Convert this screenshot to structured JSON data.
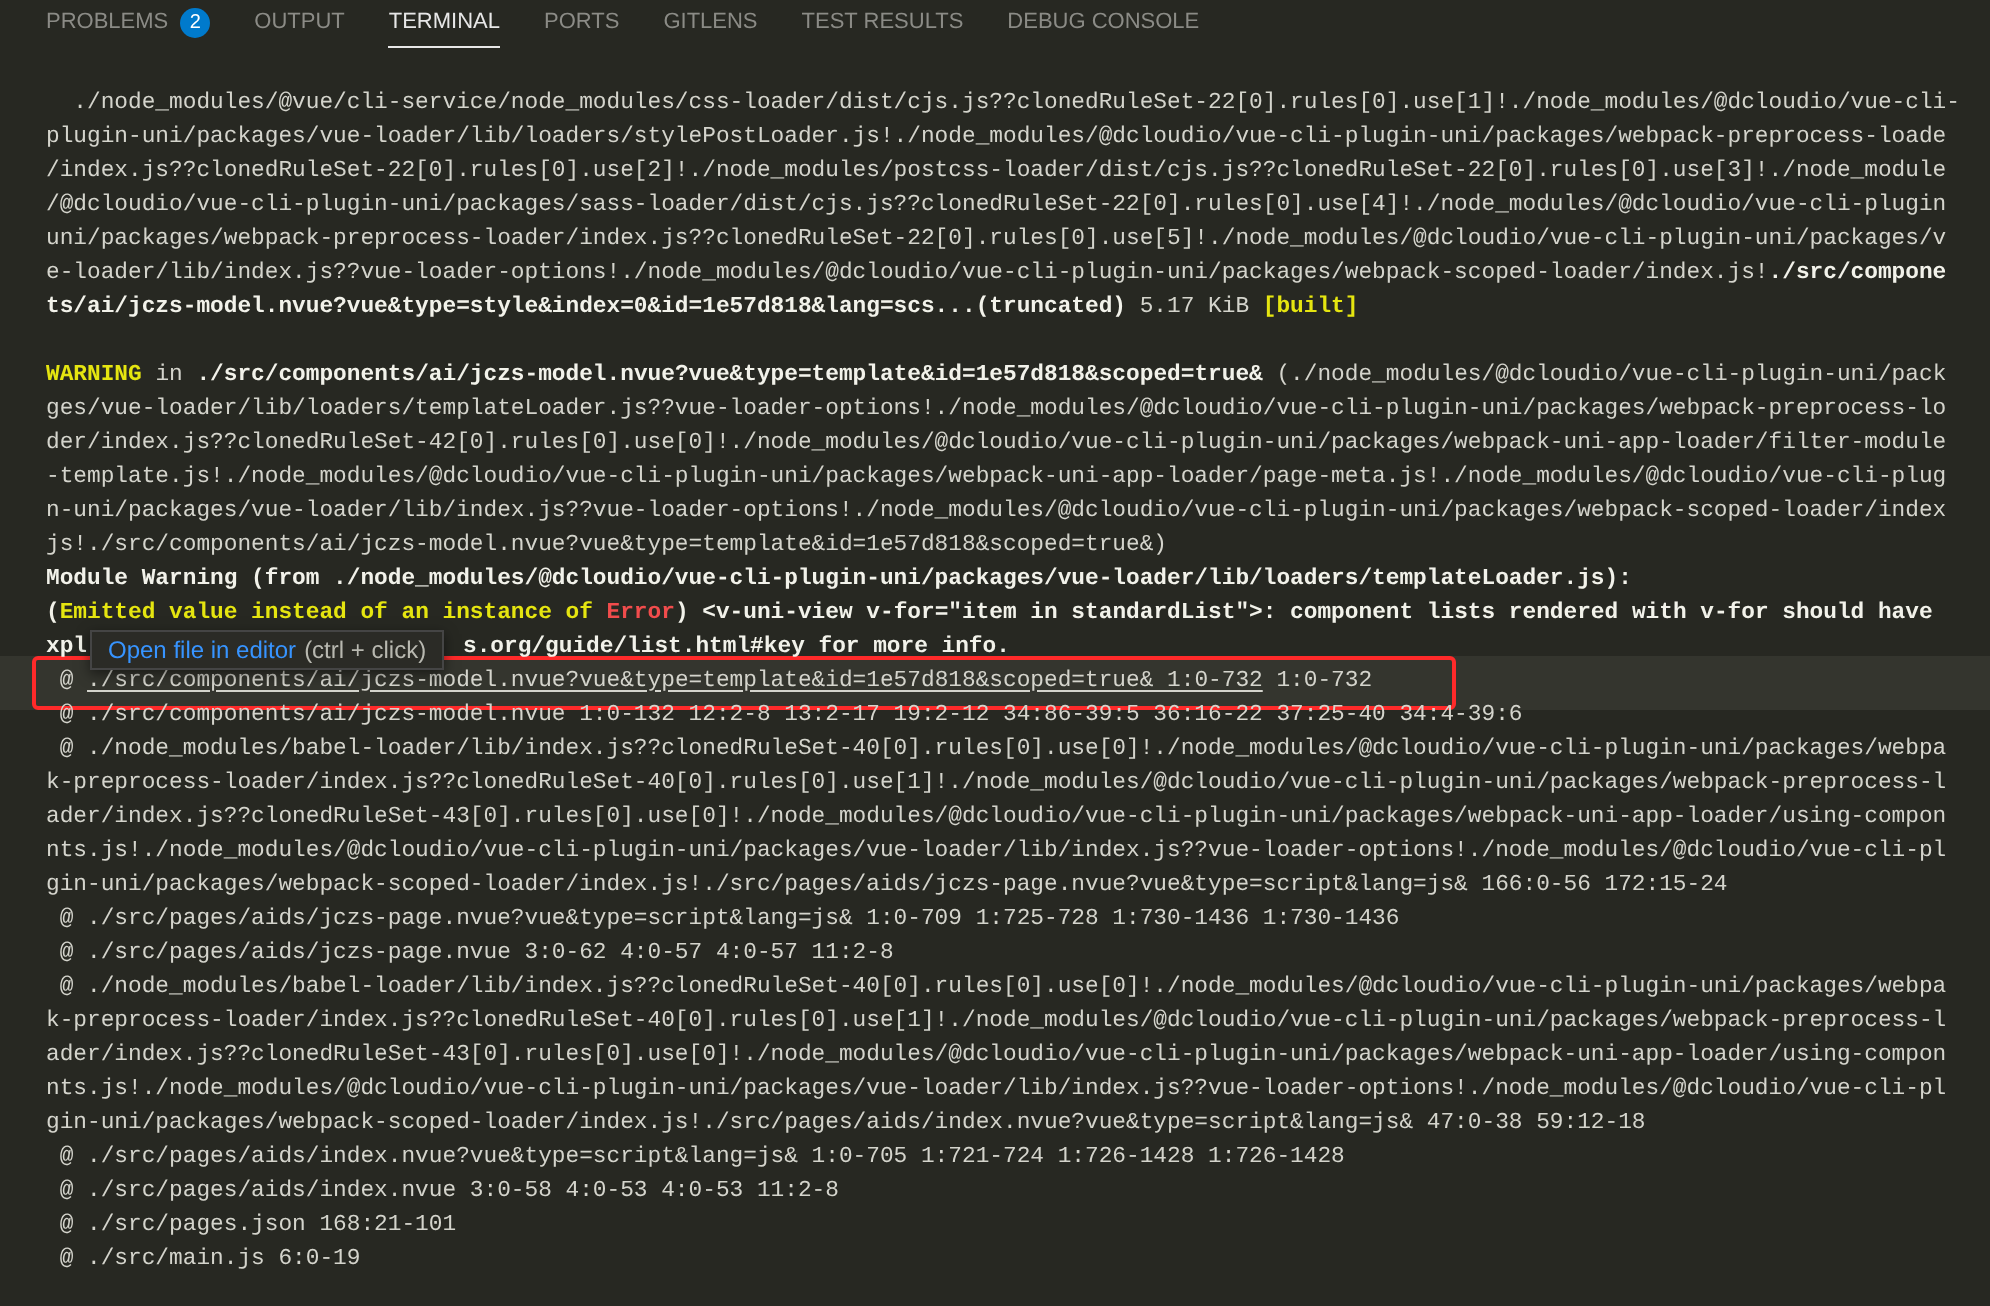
{
  "tabs": [
    {
      "label": "PROBLEMS",
      "selected": false,
      "badge": "2"
    },
    {
      "label": "OUTPUT",
      "selected": false
    },
    {
      "label": "TERMINAL",
      "selected": true
    },
    {
      "label": "PORTS",
      "selected": false
    },
    {
      "label": "GITLENS",
      "selected": false
    },
    {
      "label": "TEST RESULTS",
      "selected": false
    },
    {
      "label": "DEBUG CONSOLE",
      "selected": false
    }
  ],
  "terminal": {
    "lines": [
      {
        "kind": "text",
        "segments": [
          {
            "kind": "plain",
            "text": "  ./node_modules/@vue/cli-service/node_modules/css-loader/dist/cjs.js??clonedRuleSet-22[0].rules[0].use[1]!./node_modules/@dcloudio/vue-cli-"
          }
        ]
      },
      {
        "kind": "text",
        "segments": [
          {
            "kind": "plain",
            "text": "plugin-uni/packages/vue-loader/lib/loaders/stylePostLoader.js!./node_modules/@dcloudio/vue-cli-plugin-uni/packages/webpack-preprocess-loade"
          }
        ]
      },
      {
        "kind": "text",
        "segments": [
          {
            "kind": "plain",
            "text": "/index.js??clonedRuleSet-22[0].rules[0].use[2]!./node_modules/postcss-loader/dist/cjs.js??clonedRuleSet-22[0].rules[0].use[3]!./node_module"
          }
        ]
      },
      {
        "kind": "text",
        "segments": [
          {
            "kind": "plain",
            "text": "/@dcloudio/vue-cli-plugin-uni/packages/sass-loader/dist/cjs.js??clonedRuleSet-22[0].rules[0].use[4]!./node_modules/@dcloudio/vue-cli-plugin"
          }
        ]
      },
      {
        "kind": "text",
        "segments": [
          {
            "kind": "plain",
            "text": "uni/packages/webpack-preprocess-loader/index.js??clonedRuleSet-22[0].rules[0].use[5]!./node_modules/@dcloudio/vue-cli-plugin-uni/packages/v"
          }
        ]
      },
      {
        "kind": "text",
        "segments": [
          {
            "kind": "plain",
            "text": "e-loader/lib/index.js??vue-loader-options!./node_modules/@dcloudio/vue-cli-plugin-uni/packages/webpack-scoped-loader/index.js!"
          },
          {
            "kind": "bold",
            "text": "./src/compone"
          }
        ]
      },
      {
        "kind": "text",
        "segments": [
          {
            "kind": "bold",
            "text": "ts/ai/jczs-model.nvue?vue&type=style&index=0&id=1e57d818&lang=scs...(truncated)"
          },
          {
            "kind": "plain",
            "text": " 5.17 KiB "
          },
          {
            "kind": "yellow",
            "text": "[built]"
          }
        ]
      },
      {
        "kind": "blank"
      },
      {
        "kind": "text",
        "segments": [
          {
            "kind": "warn",
            "text": "WARNING"
          },
          {
            "kind": "plain",
            "text": " in "
          },
          {
            "kind": "bold",
            "text": "./src/components/ai/jczs-model.nvue?vue&type=template&id=1e57d818&scoped=true&"
          },
          {
            "kind": "plain",
            "text": " (./node_modules/@dcloudio/vue-cli-plugin-uni/pack"
          }
        ]
      },
      {
        "kind": "text",
        "segments": [
          {
            "kind": "plain",
            "text": "ges/vue-loader/lib/loaders/templateLoader.js??vue-loader-options!./node_modules/@dcloudio/vue-cli-plugin-uni/packages/webpack-preprocess-lo"
          }
        ]
      },
      {
        "kind": "text",
        "segments": [
          {
            "kind": "plain",
            "text": "der/index.js??clonedRuleSet-42[0].rules[0].use[0]!./node_modules/@dcloudio/vue-cli-plugin-uni/packages/webpack-uni-app-loader/filter-module"
          }
        ]
      },
      {
        "kind": "text",
        "segments": [
          {
            "kind": "plain",
            "text": "-template.js!./node_modules/@dcloudio/vue-cli-plugin-uni/packages/webpack-uni-app-loader/page-meta.js!./node_modules/@dcloudio/vue-cli-plug"
          }
        ]
      },
      {
        "kind": "text",
        "segments": [
          {
            "kind": "plain",
            "text": "n-uni/packages/vue-loader/lib/index.js??vue-loader-options!./node_modules/@dcloudio/vue-cli-plugin-uni/packages/webpack-scoped-loader/index"
          }
        ]
      },
      {
        "kind": "text",
        "segments": [
          {
            "kind": "plain",
            "text": "js!./src/components/ai/jczs-model.nvue?vue&type=template&id=1e57d818&scoped=true&)"
          }
        ]
      },
      {
        "kind": "text",
        "segments": [
          {
            "kind": "bold",
            "text": "Module Warning (from ./node_modules/@dcloudio/vue-cli-plugin-uni/packages/vue-loader/lib/loaders/templateLoader.js):"
          }
        ]
      },
      {
        "kind": "text",
        "segments": [
          {
            "kind": "bold",
            "text": "("
          },
          {
            "kind": "yellow",
            "text": "Emitted value instead of an instance of "
          },
          {
            "kind": "error",
            "text": "Error"
          },
          {
            "kind": "bold",
            "text": ") <v-uni-view v-for=\"item in standardList\">: component lists rendered with v-for should have"
          }
        ]
      },
      {
        "kind": "fragments",
        "segments": [
          {
            "kind": "bold",
            "text": "xpl"
          },
          {
            "kind": "bold",
            "text": "s.org/guide/list.html#key for more info."
          }
        ]
      },
      {
        "kind": "annotated",
        "segments": [
          {
            "kind": "plain",
            "text": " @ "
          },
          {
            "kind": "link",
            "text": "./src/components/ai/jczs-model.nvue?vue&type=template&id=1e57d818&scoped=true& 1:0-732"
          },
          {
            "kind": "plain",
            "text": " 1:0-732"
          }
        ]
      },
      {
        "kind": "text",
        "segments": [
          {
            "kind": "plain",
            "text": " @ ./src/components/ai/jczs-model.nvue 1:0-132 12:2-8 13:2-17 19:2-12 34:86-39:5 36:16-22 37:25-40 34:4-39:6"
          }
        ]
      },
      {
        "kind": "text",
        "segments": [
          {
            "kind": "plain",
            "text": " @ ./node_modules/babel-loader/lib/index.js??clonedRuleSet-40[0].rules[0].use[0]!./node_modules/@dcloudio/vue-cli-plugin-uni/packages/webpa"
          }
        ]
      },
      {
        "kind": "text",
        "segments": [
          {
            "kind": "plain",
            "text": "k-preprocess-loader/index.js??clonedRuleSet-40[0].rules[0].use[1]!./node_modules/@dcloudio/vue-cli-plugin-uni/packages/webpack-preprocess-l"
          }
        ]
      },
      {
        "kind": "text",
        "segments": [
          {
            "kind": "plain",
            "text": "ader/index.js??clonedRuleSet-43[0].rules[0].use[0]!./node_modules/@dcloudio/vue-cli-plugin-uni/packages/webpack-uni-app-loader/using-compon"
          }
        ]
      },
      {
        "kind": "text",
        "segments": [
          {
            "kind": "plain",
            "text": "nts.js!./node_modules/@dcloudio/vue-cli-plugin-uni/packages/vue-loader/lib/index.js??vue-loader-options!./node_modules/@dcloudio/vue-cli-pl"
          }
        ]
      },
      {
        "kind": "text",
        "segments": [
          {
            "kind": "plain",
            "text": "gin-uni/packages/webpack-scoped-loader/index.js!./src/pages/aids/jczs-page.nvue?vue&type=script&lang=js& 166:0-56 172:15-24"
          }
        ]
      },
      {
        "kind": "text",
        "segments": [
          {
            "kind": "plain",
            "text": " @ ./src/pages/aids/jczs-page.nvue?vue&type=script&lang=js& 1:0-709 1:725-728 1:730-1436 1:730-1436"
          }
        ]
      },
      {
        "kind": "text",
        "segments": [
          {
            "kind": "plain",
            "text": " @ ./src/pages/aids/jczs-page.nvue 3:0-62 4:0-57 4:0-57 11:2-8"
          }
        ]
      },
      {
        "kind": "text",
        "segments": [
          {
            "kind": "plain",
            "text": " @ ./node_modules/babel-loader/lib/index.js??clonedRuleSet-40[0].rules[0].use[0]!./node_modules/@dcloudio/vue-cli-plugin-uni/packages/webpa"
          }
        ]
      },
      {
        "kind": "text",
        "segments": [
          {
            "kind": "plain",
            "text": "k-preprocess-loader/index.js??clonedRuleSet-40[0].rules[0].use[1]!./node_modules/@dcloudio/vue-cli-plugin-uni/packages/webpack-preprocess-l"
          }
        ]
      },
      {
        "kind": "text",
        "segments": [
          {
            "kind": "plain",
            "text": "ader/index.js??clonedRuleSet-43[0].rules[0].use[0]!./node_modules/@dcloudio/vue-cli-plugin-uni/packages/webpack-uni-app-loader/using-compon"
          }
        ]
      },
      {
        "kind": "text",
        "segments": [
          {
            "kind": "plain",
            "text": "nts.js!./node_modules/@dcloudio/vue-cli-plugin-uni/packages/vue-loader/lib/index.js??vue-loader-options!./node_modules/@dcloudio/vue-cli-pl"
          }
        ]
      },
      {
        "kind": "text",
        "segments": [
          {
            "kind": "plain",
            "text": "gin-uni/packages/webpack-scoped-loader/index.js!./src/pages/aids/index.nvue?vue&type=script&lang=js& 47:0-38 59:12-18"
          }
        ]
      },
      {
        "kind": "text",
        "segments": [
          {
            "kind": "plain",
            "text": " @ ./src/pages/aids/index.nvue?vue&type=script&lang=js& 1:0-705 1:721-724 1:726-1428 1:726-1428"
          }
        ]
      },
      {
        "kind": "text",
        "segments": [
          {
            "kind": "plain",
            "text": " @ ./src/pages/aids/index.nvue 3:0-58 4:0-53 4:0-53 11:2-8"
          }
        ]
      },
      {
        "kind": "text",
        "segments": [
          {
            "kind": "plain",
            "text": " @ ./src/pages.json 168:21-101"
          }
        ]
      },
      {
        "kind": "text",
        "segments": [
          {
            "kind": "plain",
            "text": " @ ./src/main.js 6:0-19"
          }
        ]
      }
    ],
    "tooltip": {
      "action": "Open file in editor",
      "hint": "(ctrl + click)"
    }
  }
}
